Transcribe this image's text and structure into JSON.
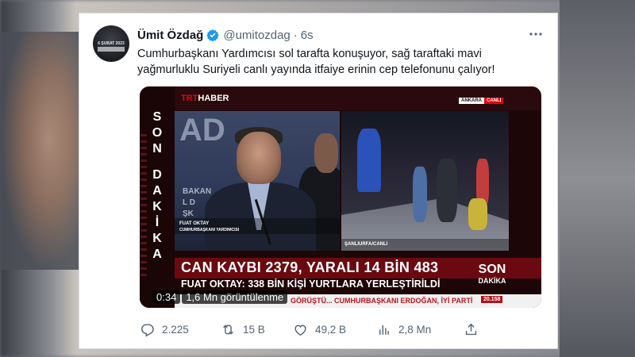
{
  "tweet": {
    "display_name": "Ümit Özdağ",
    "handle": "@umitozdag",
    "separator": "·",
    "time": "6s",
    "text": "Cumhurbaşkanı Yardımcısı sol tarafta konuşuyor, sağ taraftaki mavi yağmurluklu Suriyeli canlı yayında itfaiye erinin cep telefonunu çalıyor!",
    "avatar_text": "6 ŞUBAT 2023"
  },
  "video": {
    "channel_prefix": "TRT",
    "channel_suffix": "HABER",
    "rail_top": [
      "S",
      "O",
      "N"
    ],
    "rail_bottom": [
      "D",
      "A",
      "K",
      "İ",
      "K",
      "A"
    ],
    "background_letters": "AD",
    "podium_text": [
      "BAKAN",
      "L D",
      "ŞK"
    ],
    "left_caption_name": "FUAT OKTAY",
    "left_caption_title": "CUMHURBAŞKANI YARDIMCISI",
    "live_city": "ANKARA",
    "live_label": "CANLI",
    "right_caption": "ŞANLIURFA/CANLI",
    "headline": "CAN KAYBI 2379, YARALI 14 BİN 483",
    "subheadline": "FUAT OKTAY: 338 BİN KİŞİ YURTLARA YERLEŞTİRİLDİ",
    "son_dakika_1": "SON",
    "son_dakika_2": "DAKİKA",
    "ticker_text": "GÖRÜŞTÜ... CUMHURBAŞKANI ERDOĞAN, İYİ PARTİ",
    "ticker_value": "20.158",
    "timestamp": "0:34",
    "views": "1,6 Mn görüntülenme"
  },
  "actions": {
    "replies": "2.225",
    "retweets": "15 B",
    "likes": "49,2 B",
    "views": "2,8 Mn"
  },
  "icons": [
    "verified-icon",
    "more-icon",
    "reply-icon",
    "retweet-icon",
    "like-icon",
    "views-icon",
    "share-icon"
  ],
  "colors": {
    "verified": "#1d9bf0",
    "muted": "#536471",
    "text": "#0f1419",
    "trt_red": "#e30613"
  }
}
